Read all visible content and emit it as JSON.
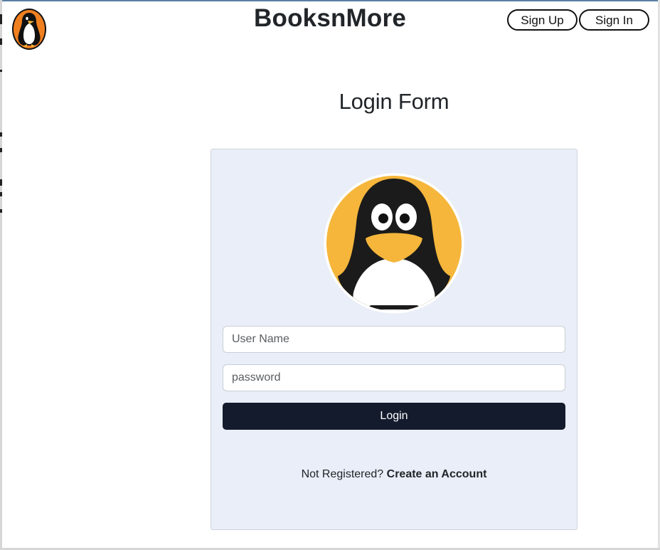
{
  "header": {
    "brand": "BooksnMore",
    "logo_icon": "penguin-logo-icon",
    "sign_up_label": "Sign Up",
    "sign_in_label": "Sign In"
  },
  "login": {
    "title": "Login Form",
    "avatar_icon": "penguin-avatar-icon",
    "username_placeholder": "User Name",
    "username_value": "",
    "password_placeholder": "password",
    "password_value": "",
    "submit_label": "Login",
    "register_prompt": "Not Registered?",
    "register_link": "Create an Account"
  },
  "colors": {
    "logo_orange": "#f07f20",
    "avatar_yellow": "#f5b63b",
    "card_background": "#e9eef8",
    "login_button": "#141b2d"
  }
}
